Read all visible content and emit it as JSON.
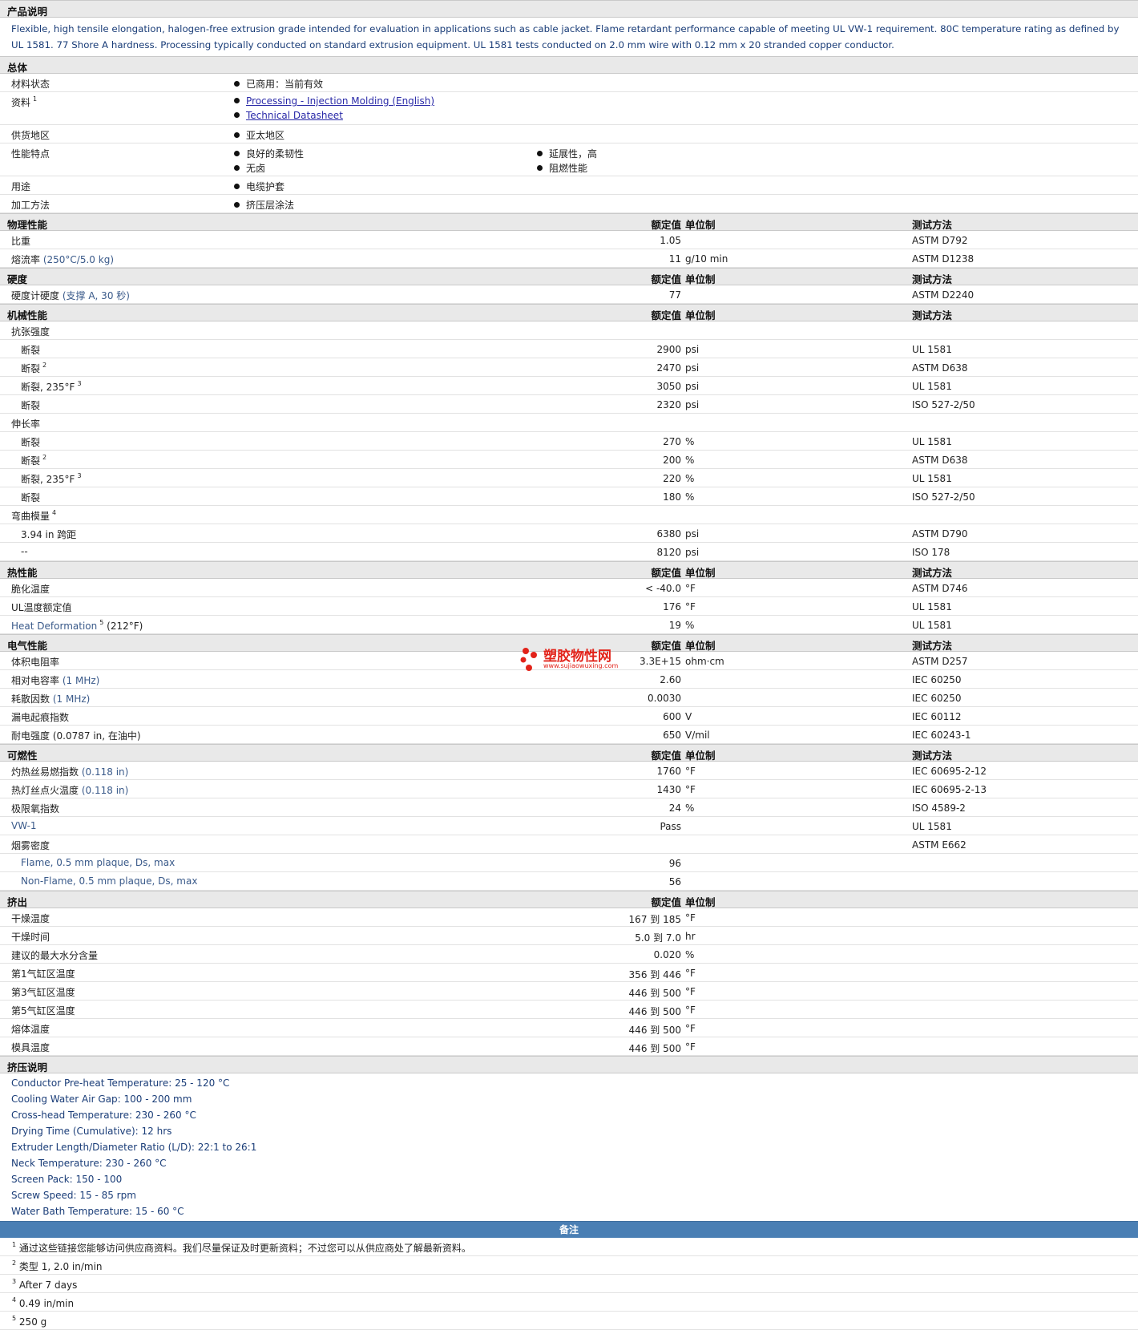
{
  "description_header": "产品说明",
  "description": "Flexible, high tensile elongation, halogen-free extrusion grade intended for evaluation in applications such as cable jacket. Flame retardant performance capable of meeting UL VW-1 requirement. 80C temperature rating as defined by UL 1581. 77 Shore A hardness. Processing typically conducted on standard extrusion equipment. UL 1581 tests conducted on 2.0 mm wire with 0.12 mm x 20 stranded copper conductor.",
  "general": {
    "title": "总体",
    "status_label": "材料状态",
    "status_value": "已商用：当前有效",
    "docs_label": "资料",
    "docs_sup": "1",
    "doc1": "Processing - Injection Molding (English)",
    "doc2": "Technical Datasheet",
    "region_label": "供货地区",
    "region_value": "亚太地区",
    "features_label": "性能特点",
    "feature1": "良好的柔韧性",
    "feature2": "延展性，高",
    "feature3": "无卤",
    "feature4": "阻燃性能",
    "use_label": "用途",
    "use_value": "电缆护套",
    "proc_label": "加工方法",
    "proc_value": "挤压层涂法"
  },
  "columns": {
    "nominal": "额定值",
    "unit": "单位制",
    "method": "测试方法"
  },
  "physical": {
    "title": "物理性能",
    "r1": {
      "label": "比重",
      "value": "1.05",
      "unit": "",
      "method": "ASTM D792"
    },
    "r2": {
      "label": "熔流率",
      "cond": "(250°C/5.0 kg)",
      "value": "11",
      "unit": "g/10 min",
      "method": "ASTM D1238"
    }
  },
  "hardness": {
    "title": "硬度",
    "r1": {
      "label": "硬度计硬度",
      "cond": "(支撑 A, 30 秒)",
      "value": "77",
      "unit": "",
      "method": "ASTM D2240"
    }
  },
  "mechanical": {
    "title": "机械性能",
    "tensile": "抗张强度",
    "t1": {
      "label": "断裂",
      "value": "2900",
      "unit": "psi",
      "method": "UL 1581"
    },
    "t2": {
      "label": "断裂",
      "sup": "2",
      "value": "2470",
      "unit": "psi",
      "method": "ASTM D638"
    },
    "t3": {
      "label": "断裂, 235°F",
      "sup": "3",
      "value": "3050",
      "unit": "psi",
      "method": "UL 1581"
    },
    "t4": {
      "label": "断裂",
      "value": "2320",
      "unit": "psi",
      "method": "ISO 527-2/50"
    },
    "elong": "伸长率",
    "e1": {
      "label": "断裂",
      "value": "270",
      "unit": "%",
      "method": "UL 1581"
    },
    "e2": {
      "label": "断裂",
      "sup": "2",
      "value": "200",
      "unit": "%",
      "method": "ASTM D638"
    },
    "e3": {
      "label": "断裂, 235°F",
      "sup": "3",
      "value": "220",
      "unit": "%",
      "method": "UL 1581"
    },
    "e4": {
      "label": "断裂",
      "value": "180",
      "unit": "%",
      "method": "ISO 527-2/50"
    },
    "flex": "弯曲模量",
    "flex_sup": "4",
    "f1": {
      "label": "3.94 in 跨距",
      "value": "6380",
      "unit": "psi",
      "method": "ASTM D790"
    },
    "f2": {
      "label": "--",
      "value": "8120",
      "unit": "psi",
      "method": "ISO 178"
    }
  },
  "thermal": {
    "title": "热性能",
    "r1": {
      "label": "脆化温度",
      "value": "< -40.0",
      "unit": "°F",
      "method": "ASTM D746"
    },
    "r2": {
      "label": "UL温度额定值",
      "value": "176",
      "unit": "°F",
      "method": "UL 1581"
    },
    "r3": {
      "label": "Heat Deformation",
      "sup": "5",
      "cond": "(212°F)",
      "value": "19",
      "unit": "%",
      "method": "UL 1581"
    }
  },
  "electrical": {
    "title": "电气性能",
    "r1": {
      "label": "体积电阻率",
      "value": "3.3E+15",
      "unit": "ohm·cm",
      "method": "ASTM D257"
    },
    "r2": {
      "label": "相对电容率",
      "cond": "(1 MHz)",
      "value": "2.60",
      "unit": "",
      "method": "IEC 60250"
    },
    "r3": {
      "label": "耗散因数",
      "cond": "(1 MHz)",
      "value": "0.0030",
      "unit": "",
      "method": "IEC 60250"
    },
    "r4": {
      "label": "漏电起痕指数",
      "value": "600",
      "unit": "V",
      "method": "IEC 60112"
    },
    "r5": {
      "label": "耐电强度",
      "cond": "(0.0787 in, 在油中)",
      "value": "650",
      "unit": "V/mil",
      "method": "IEC 60243-1"
    }
  },
  "flammability": {
    "title": "可燃性",
    "r1": {
      "label": "灼热丝易燃指数",
      "cond": "(0.118 in)",
      "value": "1760",
      "unit": "°F",
      "method": "IEC 60695-2-12"
    },
    "r2": {
      "label": "热灯丝点火温度",
      "cond": "(0.118 in)",
      "value": "1430",
      "unit": "°F",
      "method": "IEC 60695-2-13"
    },
    "r3": {
      "label": "极限氧指数",
      "value": "24",
      "unit": "%",
      "method": "ISO 4589-2"
    },
    "r4": {
      "label": "VW-1",
      "value": "Pass",
      "unit": "",
      "method": "UL 1581"
    },
    "r5": {
      "label": "烟雾密度",
      "value": "",
      "unit": "",
      "method": "ASTM E662"
    },
    "r6": {
      "label": "Flame, 0.5 mm plaque, Ds, max",
      "value": "96",
      "unit": "",
      "method": ""
    },
    "r7": {
      "label": "Non-Flame, 0.5 mm plaque, Ds, max",
      "value": "56",
      "unit": "",
      "method": ""
    }
  },
  "extrusion": {
    "title": "挤出",
    "r1": {
      "label": "干燥温度",
      "value": "167 到  185",
      "unit": "°F"
    },
    "r2": {
      "label": "干燥时间",
      "value": "5.0 到  7.0",
      "unit": "hr"
    },
    "r3": {
      "label": "建议的最大水分含量",
      "value": "0.020",
      "unit": "%"
    },
    "r4": {
      "label": "第1气缸区温度",
      "value": "356 到  446",
      "unit": "°F"
    },
    "r5": {
      "label": "第3气缸区温度",
      "value": "446 到  500",
      "unit": "°F"
    },
    "r6": {
      "label": "第5气缸区温度",
      "value": "446 到  500",
      "unit": "°F"
    },
    "r7": {
      "label": "熔体温度",
      "value": "446 到  500",
      "unit": "°F"
    },
    "r8": {
      "label": "模具温度",
      "value": "446 到  500",
      "unit": "°F"
    }
  },
  "extrusion_notes": {
    "title": "挤压说明",
    "lines": [
      "Conductor Pre-heat Temperature: 25 - 120 °C",
      "Cooling Water Air Gap: 100 - 200 mm",
      "Cross-head Temperature: 230 - 260 °C",
      "Drying Time (Cumulative): 12 hrs",
      "Extruder Length/Diameter Ratio (L/D): 22:1 to 26:1",
      "Neck Temperature: 230 - 260 °C",
      "Screen Pack: 150 - 100",
      "Screw Speed: 15 - 85 rpm",
      "Water Bath Temperature: 15 - 60 °C"
    ]
  },
  "notes": {
    "title": "备注",
    "n1": {
      "num": "1",
      "text": "通过这些链接您能够访问供应商资料。我们尽量保证及时更新资料；不过您可以从供应商处了解最新资料。"
    },
    "n2": {
      "num": "2",
      "text": "类型  1, 2.0 in/min"
    },
    "n3": {
      "num": "3",
      "text": "After 7 days"
    },
    "n4": {
      "num": "4",
      "text": "0.49 in/min"
    },
    "n5": {
      "num": "5",
      "text": "250 g"
    }
  },
  "watermark": {
    "title": "塑胶物性网",
    "url": "www.sujiaowuxing.com",
    "color": "#e2231a"
  }
}
